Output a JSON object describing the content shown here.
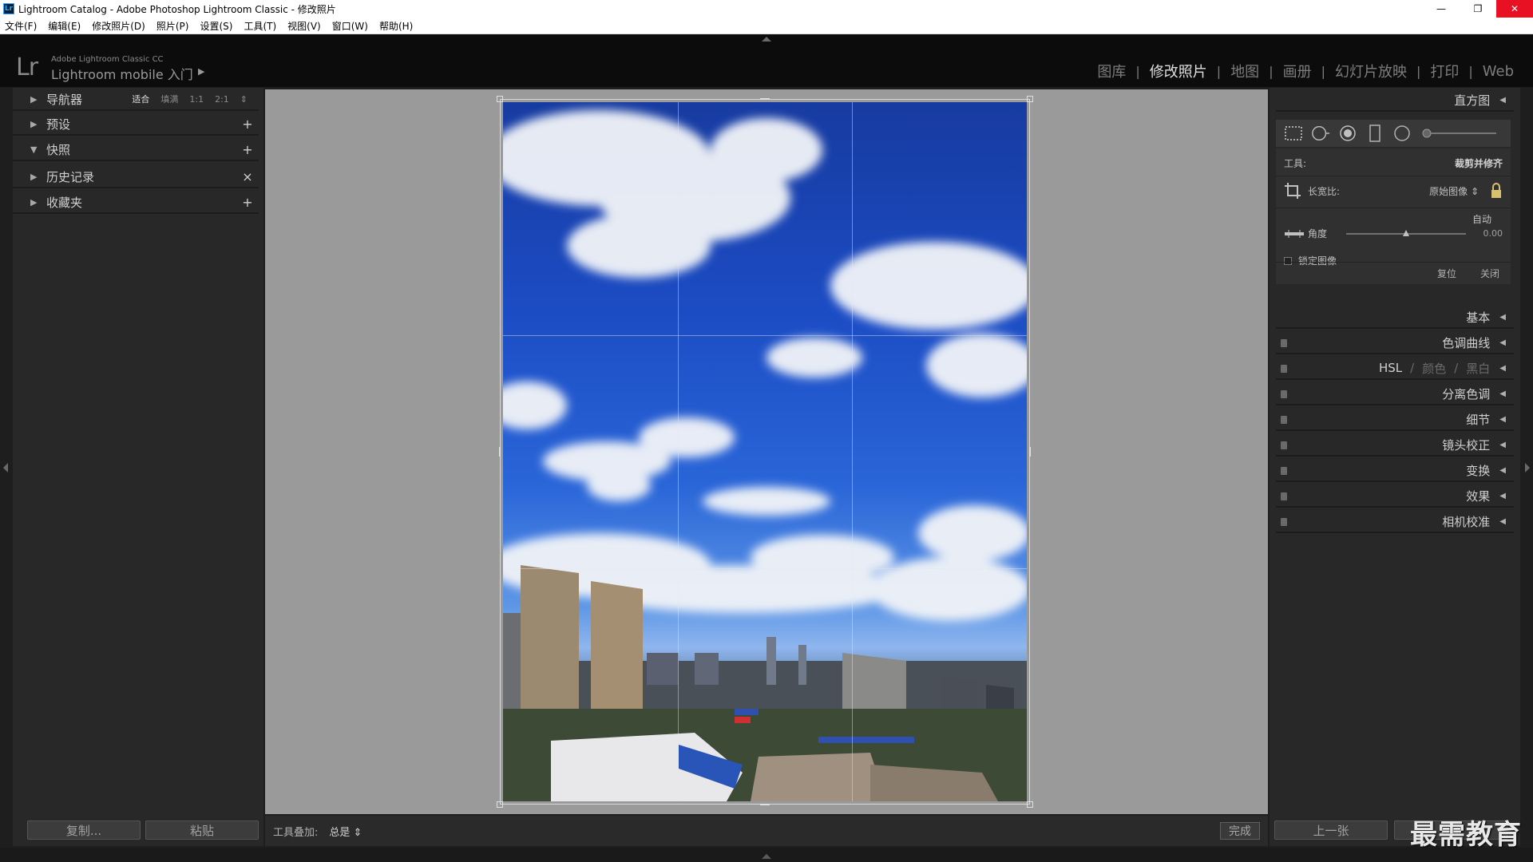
{
  "window": {
    "title": "Lightroom Catalog - Adobe Photoshop Lightroom Classic - 修改照片",
    "app_icon": "Lr",
    "minimize": "—",
    "restore": "❐",
    "close": "✕"
  },
  "menu": [
    "文件(F)",
    "编辑(E)",
    "修改照片(D)",
    "照片(P)",
    "设置(S)",
    "工具(T)",
    "视图(V)",
    "窗口(W)",
    "帮助(H)"
  ],
  "identity": {
    "logo": "Lr",
    "product": "Adobe Lightroom Classic CC",
    "mobile": "Lightroom mobile 入门",
    "arrow": "▶"
  },
  "modules": [
    {
      "label": "图库",
      "active": false
    },
    {
      "label": "修改照片",
      "active": true
    },
    {
      "label": "地图",
      "active": false
    },
    {
      "label": "画册",
      "active": false
    },
    {
      "label": "幻灯片放映",
      "active": false
    },
    {
      "label": "打印",
      "active": false
    },
    {
      "label": "Web",
      "active": false
    }
  ],
  "left_panel": {
    "navigator": {
      "label": "导航器",
      "options": [
        "适合",
        "填满",
        "1:1",
        "2:1"
      ],
      "selected": "适合",
      "stepper": "⇕"
    },
    "presets": {
      "label": "预设",
      "action": "+"
    },
    "snapshots": {
      "label": "快照",
      "action": "+"
    },
    "history": {
      "label": "历史记录",
      "action": "×"
    },
    "collections": {
      "label": "收藏夹",
      "action": "+"
    },
    "copy_button": "复制...",
    "paste_button": "粘贴"
  },
  "toolbar": {
    "overlay_label": "工具叠加:",
    "overlay_value": "总是 ⇕",
    "done_button": "完成"
  },
  "right_panel": {
    "histogram": {
      "label": "直方图"
    },
    "crop": {
      "tool_label": "工具:",
      "tool_name": "裁剪并修齐",
      "aspect_label": "长宽比:",
      "aspect_value": "原始图像 ⇕",
      "auto": "自动",
      "angle_label": "角度",
      "angle_value": "0.00",
      "angle_fraction": 0.5,
      "constrain_label": "锁定图像",
      "reset": "复位",
      "close": "关闭"
    },
    "sections": [
      {
        "label": "基本",
        "switch": false
      },
      {
        "label": "色调曲线",
        "switch": true
      },
      {
        "label": "HSL",
        "extra": [
          "/",
          "颜色",
          "/",
          "黑白"
        ],
        "switch": true
      },
      {
        "label": "分离色调",
        "switch": true
      },
      {
        "label": "细节",
        "switch": true
      },
      {
        "label": "镜头校正",
        "switch": true
      },
      {
        "label": "变换",
        "switch": true
      },
      {
        "label": "效果",
        "switch": true
      },
      {
        "label": "相机校准",
        "switch": true
      }
    ],
    "prev_button": "上一张",
    "reset_button": "复位"
  },
  "watermark": "最需教育",
  "icons": {
    "collapse": "◀",
    "expand": "▶",
    "panel_tri_open": "▼"
  }
}
